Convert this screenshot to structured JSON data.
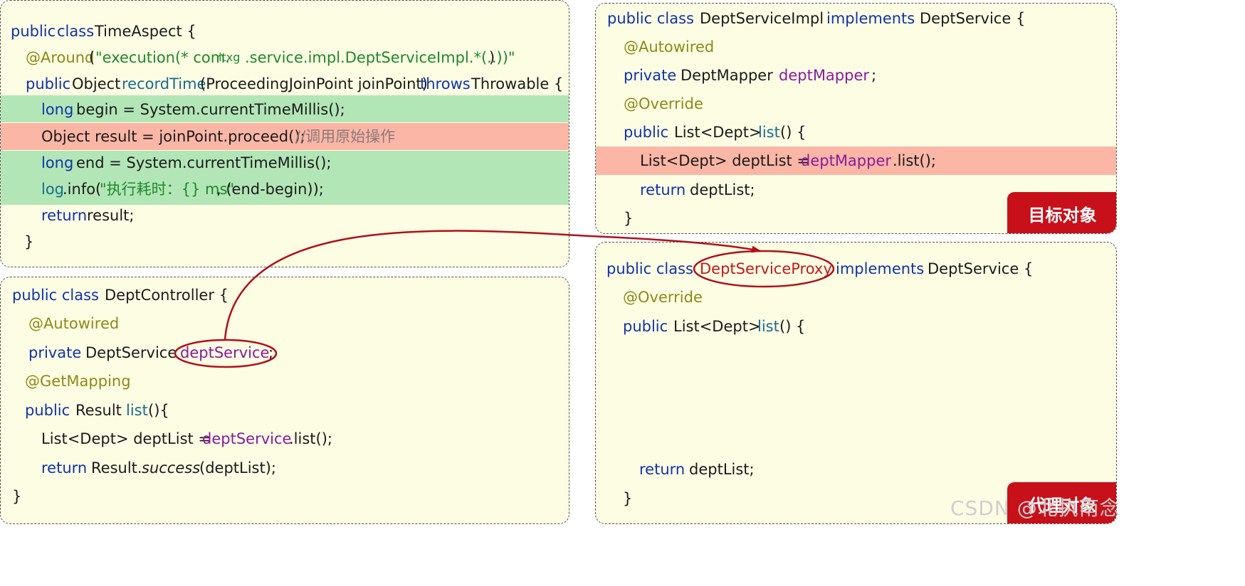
{
  "time_aspect": {
    "lines": [
      [
        "public",
        "class",
        "TimeAspect {"
      ],
      [
        "@Around",
        "(",
        "\"execution(* com.",
        "itxg",
        ".service.impl.DeptServiceImpl.*(..))\"",
        ")"
      ],
      [
        "public",
        "Object",
        "recordTime",
        "(ProceedingJoinPoint joinPoint)",
        "throws",
        "Throwable {"
      ],
      [
        "long",
        "begin = System.currentTimeMillis();"
      ],
      [
        "Object result = joinPoint.proceed();",
        "//调用原始操作"
      ],
      [
        "long",
        "end = System.currentTimeMillis();"
      ],
      [
        "log",
        ".info(",
        "\"执行耗时：{} ms\"",
        ", (end-begin));"
      ],
      [
        "return",
        "result;"
      ],
      [
        "}"
      ]
    ]
  },
  "dept_controller": {
    "lines": [
      [
        "public class",
        "DeptController {"
      ],
      [
        "@Autowired"
      ],
      [
        "private",
        "DeptService",
        "deptService",
        ";"
      ],
      [
        "@GetMapping"
      ],
      [
        "public",
        "Result",
        "list",
        "(){"
      ],
      [
        "List<Dept> deptList =",
        "deptService",
        ".list();"
      ],
      [
        "return",
        "Result.",
        "success",
        "(deptList);"
      ],
      [
        "}"
      ]
    ]
  },
  "dept_service_impl": {
    "lines": [
      [
        "public class",
        "DeptServiceImpl",
        "implements",
        "DeptService {"
      ],
      [
        "@Autowired"
      ],
      [
        "private",
        "DeptMapper",
        "deptMapper",
        ";"
      ],
      [
        "@Override"
      ],
      [
        "public",
        "List<Dept>",
        "list",
        "() {"
      ],
      [
        "List<Dept> deptList =",
        "deptMapper",
        ".list();"
      ],
      [
        "return",
        "deptList;"
      ],
      [
        "}"
      ]
    ],
    "badge": "目标对象"
  },
  "dept_service_proxy": {
    "lines": [
      [
        "public class",
        "DeptServiceProxy",
        "implements",
        "DeptService {"
      ],
      [
        "@Override"
      ],
      [
        "public",
        "List<Dept>",
        "list",
        "() {"
      ],
      [
        "return",
        "deptList;"
      ],
      [
        "}"
      ]
    ],
    "badge": "代理对象"
  },
  "watermark": "CSDN @北执南念",
  "colors": {
    "keyword": "#1033a8",
    "annotation": "#8c8a14",
    "string": "#1d8a2a",
    "field": "#8a1a9c",
    "highlight_green": "#b3e6b7",
    "highlight_red": "#fbb6a6",
    "badge_red": "#c8101a",
    "arrow_red": "#b0101a"
  }
}
